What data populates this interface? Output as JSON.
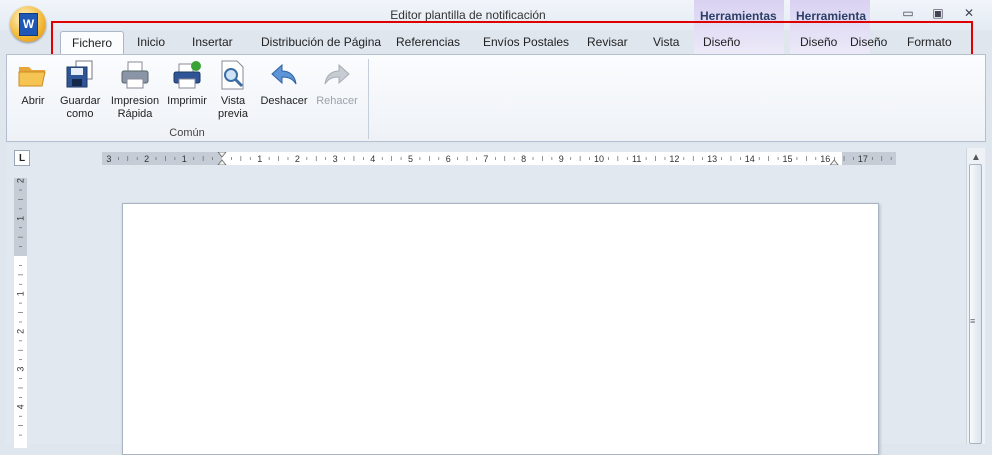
{
  "window": {
    "title": "Editor plantilla de notificación",
    "app_icon_letter": "W",
    "context_groups": [
      "Herramientas",
      "Herramienta"
    ],
    "controls": {
      "minimize": "▭",
      "restore": "▣",
      "close": "✕"
    }
  },
  "tabs": [
    {
      "label": "Fichero",
      "active": true
    },
    {
      "label": "Inicio"
    },
    {
      "label": "Insertar"
    },
    {
      "label": "Distribución de Página"
    },
    {
      "label": "Referencias"
    },
    {
      "label": "Envíos Postales"
    },
    {
      "label": "Revisar"
    },
    {
      "label": "Vista"
    },
    {
      "label": "Diseño"
    },
    {
      "label": "Diseño"
    },
    {
      "label": "Diseño"
    },
    {
      "label": "Formato"
    }
  ],
  "ribbon": {
    "group_label": "Común",
    "buttons": [
      {
        "label": "Abrir",
        "icon": "folder-open-icon"
      },
      {
        "label": "Guardar como",
        "icon": "save-as-icon"
      },
      {
        "label": "Impresion Rápida",
        "icon": "quick-print-icon"
      },
      {
        "label": "Imprimir",
        "icon": "print-icon"
      },
      {
        "label": "Vista previa",
        "icon": "print-preview-icon"
      },
      {
        "label": "Deshacer",
        "icon": "undo-icon"
      },
      {
        "label": "Rehacer",
        "icon": "redo-icon",
        "disabled": true
      }
    ]
  },
  "ruler": {
    "corner": "L",
    "h_labels": [
      "3",
      "2",
      "1",
      "1",
      "2",
      "3",
      "4",
      "5",
      "6",
      "7",
      "8",
      "9",
      "10",
      "11",
      "12",
      "13",
      "14",
      "15",
      "16",
      "17"
    ],
    "v_labels": [
      "2",
      "1",
      "1",
      "2",
      "3",
      "4"
    ]
  },
  "colors": {
    "highlight_box": "#e00000",
    "context_tab_bg": "#d9d2f2"
  }
}
